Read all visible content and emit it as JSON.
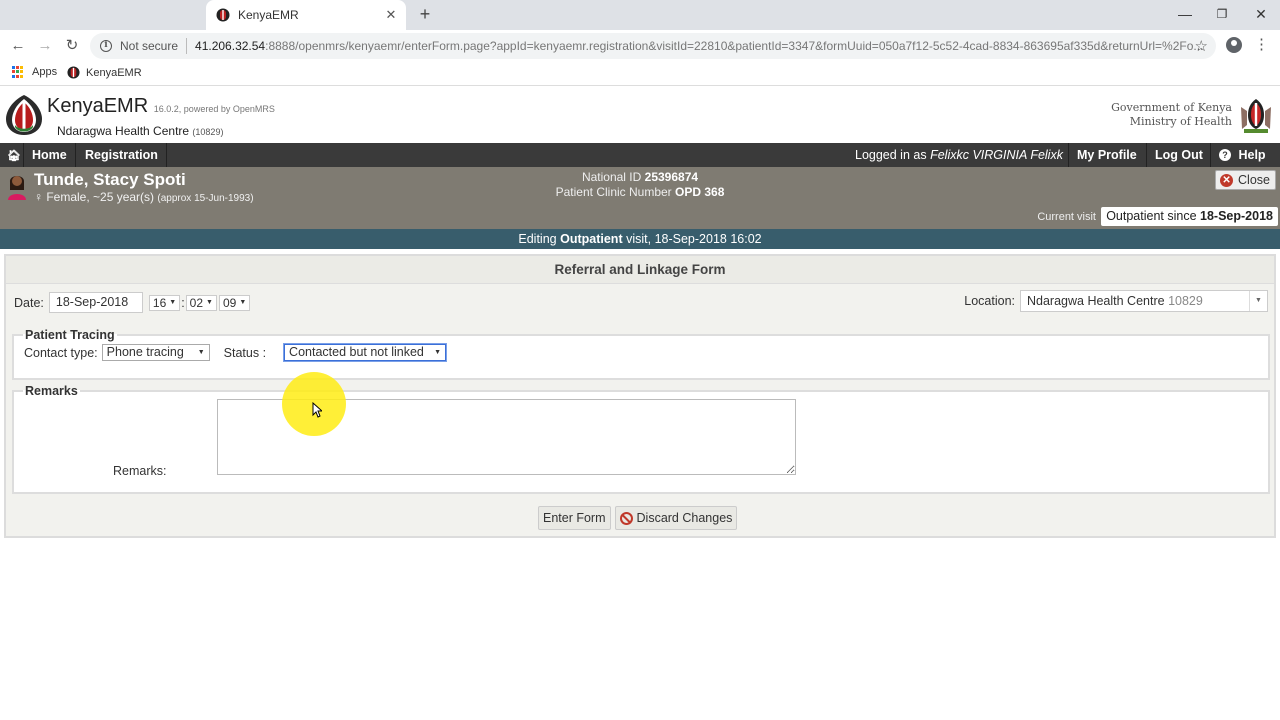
{
  "browser": {
    "tab_title": "KenyaEMR",
    "new_tab_label": "+",
    "security_label": "Not secure",
    "url_host": "41.206.32.54",
    "url_path": ":8888/openmrs/kenyaemr/enterForm.page?appId=kenyaemr.registration&visitId=22810&patientId=3347&formUuid=050a7f12-5c52-4cad-8834-863695af335d&returnUrl=%2Fo...",
    "bookmarks": [
      "Apps",
      "KenyaEMR"
    ]
  },
  "header": {
    "app_name": "KenyaEMR",
    "version": "16.0.2, powered by OpenMRS",
    "facility_name": "Ndaragwa Health Centre",
    "facility_code": "(10829)",
    "gov_line1": "Government of Kenya",
    "gov_line2": "Ministry of Health"
  },
  "nav": {
    "home": "Home",
    "registration": "Registration",
    "logged_prefix": "Logged in as",
    "logged_user": "Felixkc VIRGINIA Felixk",
    "my_profile": "My Profile",
    "logout": "Log Out",
    "help": "Help"
  },
  "patient": {
    "name": "Tunde, Stacy Spoti",
    "gender_age": "♀ Female, ~25 year(s)",
    "dob": "(approx 15-Jun-1993)",
    "national_id_label": "National ID",
    "national_id": "25396874",
    "clinic_number_label": "Patient Clinic Number",
    "clinic_number": "OPD 368",
    "close_label": "Close",
    "current_visit_label": "Current visit",
    "visit_type": "Outpatient since",
    "visit_date": "18-Sep-2018"
  },
  "edit_bar": {
    "prefix": "Editing",
    "visit_type": "Outpatient",
    "suffix": "visit, 18-Sep-2018 16:02"
  },
  "form": {
    "title": "Referral and Linkage Form",
    "date_label": "Date:",
    "date_value": "18-Sep-2018",
    "hour": "16",
    "minute": "02",
    "second": "09",
    "location_label": "Location:",
    "location_name": "Ndaragwa Health Centre",
    "location_code": "10829",
    "tracing_legend": "Patient Tracing",
    "contact_type_label": "Contact type:",
    "contact_type_value": "Phone tracing",
    "status_label": "Status :",
    "status_value": "Contacted but not linked",
    "remarks_legend": "Remarks",
    "remarks_label": "Remarks:",
    "remarks_value": "",
    "enter_button": "Enter Form",
    "discard_button": "Discard Changes"
  },
  "colors": {
    "topnav_bg": "#3a3a3a",
    "patient_bg": "#7f7b72",
    "editbar_bg": "#385d6c",
    "cursor_highlight": "#ffec14"
  }
}
